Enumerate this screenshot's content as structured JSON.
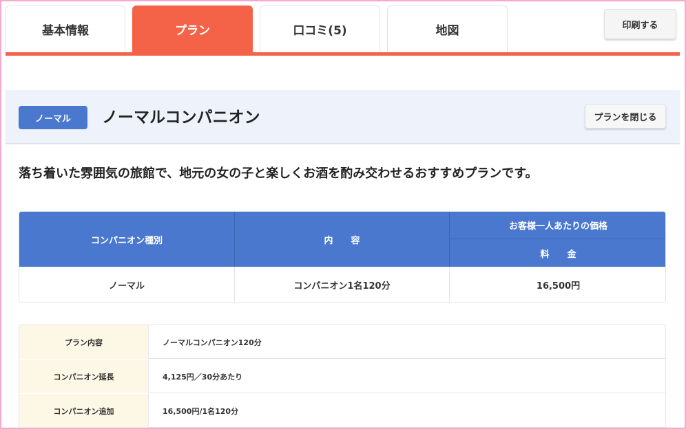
{
  "tabs": [
    {
      "label": "基本情報",
      "active": false
    },
    {
      "label": "プラン",
      "active": true
    },
    {
      "label": "口コミ(5)",
      "active": false
    },
    {
      "label": "地図",
      "active": false
    }
  ],
  "print_button": "印刷する",
  "plan": {
    "badge": "ノーマル",
    "title": "ノーマルコンパニオン",
    "close_button": "プランを閉じる",
    "description": "落ち着いた雰囲気の旅館で、地元の女の子と楽しくお酒を酌み交わせるおすすめプランです。"
  },
  "price_table": {
    "headers": {
      "type": "コンパニオン種別",
      "content": "内　　容",
      "price_group": "お客様一人あたりの価格",
      "price": "料　　金"
    },
    "rows": [
      {
        "type": "ノーマル",
        "content": "コンパニオン1名120分",
        "price": "16,500円"
      }
    ]
  },
  "details": [
    {
      "label": "プラン内容",
      "value": "ノーマルコンパニオン120分"
    },
    {
      "label": "コンパニオン延長",
      "value": "4,125円／30分あたり"
    },
    {
      "label": "コンパニオン追加",
      "value": "16,500円/1名120分"
    }
  ],
  "colors": {
    "accent": "#f46248",
    "blue": "#4a78cf",
    "frame": "#f4a9cf"
  }
}
